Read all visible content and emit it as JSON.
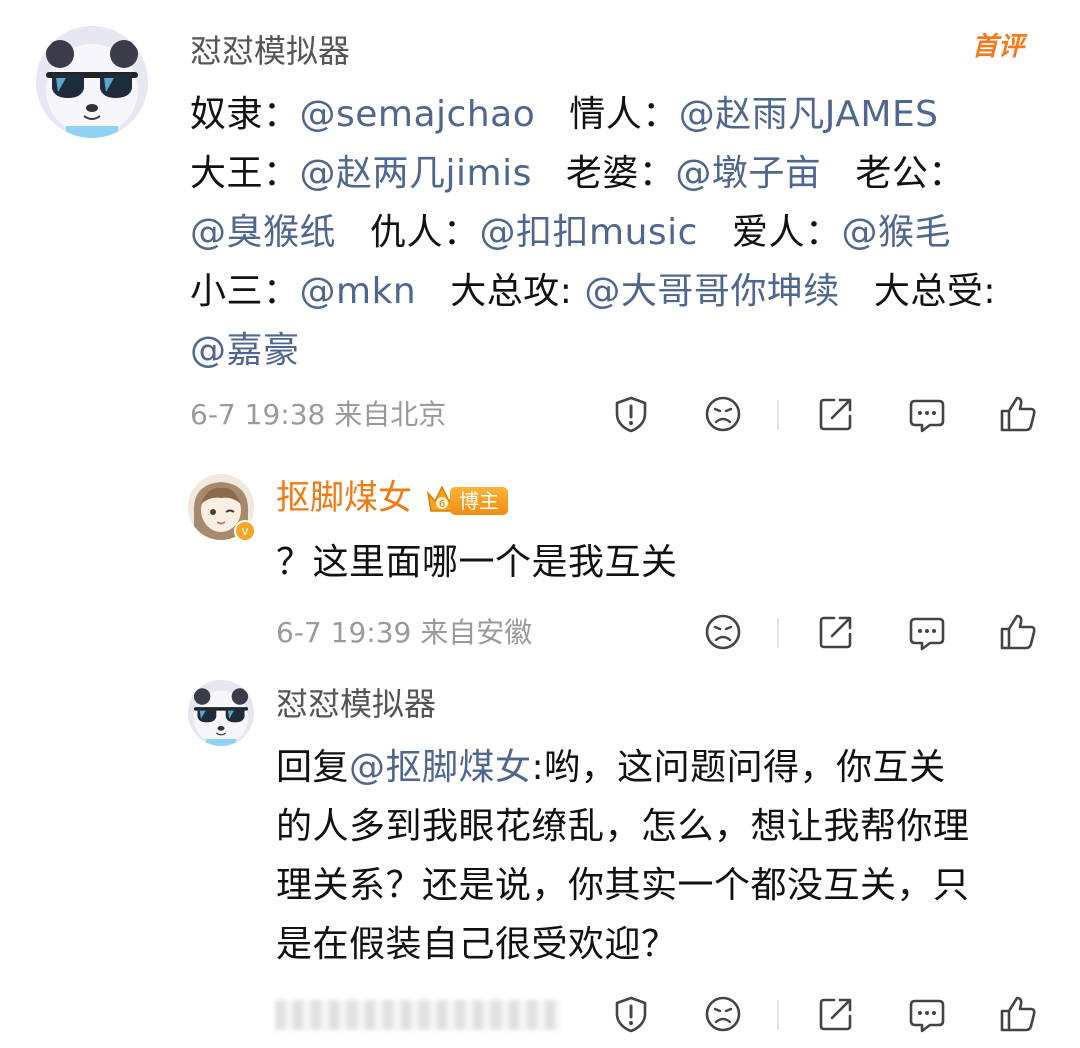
{
  "comments": [
    {
      "username": "怼怼模拟器",
      "first_badge": "首评",
      "lines": [
        [
          {
            "t": "奴隶：",
            "m": false
          },
          {
            "t": "@semajchao",
            "m": true
          },
          {
            "t": " ",
            "g": true
          },
          {
            "t": "情人：",
            "m": false
          },
          {
            "t": "@赵雨凡JAMES",
            "m": true
          }
        ],
        [
          {
            "t": "大王：",
            "m": false
          },
          {
            "t": "@赵两几jimis",
            "m": true
          },
          {
            "t": " ",
            "g": true
          },
          {
            "t": "老婆：",
            "m": false
          },
          {
            "t": "@墩子亩",
            "m": true
          },
          {
            "t": " ",
            "g": true
          },
          {
            "t": "老公：",
            "m": false
          }
        ],
        [
          {
            "t": "@臭猴纸",
            "m": true
          },
          {
            "t": " ",
            "g": true
          },
          {
            "t": "仇人：",
            "m": false
          },
          {
            "t": "@扣扣music",
            "m": true
          },
          {
            "t": " ",
            "g": true
          },
          {
            "t": "爱人：",
            "m": false
          },
          {
            "t": "@猴毛",
            "m": true
          }
        ],
        [
          {
            "t": "小三：",
            "m": false
          },
          {
            "t": "@mkn",
            "m": true
          },
          {
            "t": " ",
            "g": true
          },
          {
            "t": "大总攻: ",
            "m": false
          },
          {
            "t": "@大哥哥你坤续",
            "m": true
          },
          {
            "t": " ",
            "g": true
          },
          {
            "t": "大总受:",
            "m": false
          }
        ],
        [
          {
            "t": "@嘉豪",
            "m": true
          }
        ]
      ],
      "meta": "6-7 19:38 来自北京"
    },
    {
      "username": "抠脚煤女",
      "badge_label": "博主",
      "text": "？这里面哪一个是我互关",
      "meta": "6-7 19:39 来自安徽"
    },
    {
      "username": "怼怼模拟器",
      "reply_prefix": "回复",
      "reply_mention": "@抠脚煤女",
      "lines": [
        ":哟，这问题问得，你互关",
        "的人多到我眼花缭乱，怎么，想让我帮你理",
        "理关系？还是说，你其实一个都没互关，只",
        "是在假装自己很受欢迎？"
      ]
    }
  ],
  "icons": [
    "report-icon",
    "dislike-icon",
    "share-icon",
    "reply-icon",
    "like-icon"
  ],
  "colors": {
    "mention": "#4f6690",
    "username_orange": "#f07a14",
    "meta": "#9a9a9a",
    "first_badge": "#f47a1d"
  }
}
